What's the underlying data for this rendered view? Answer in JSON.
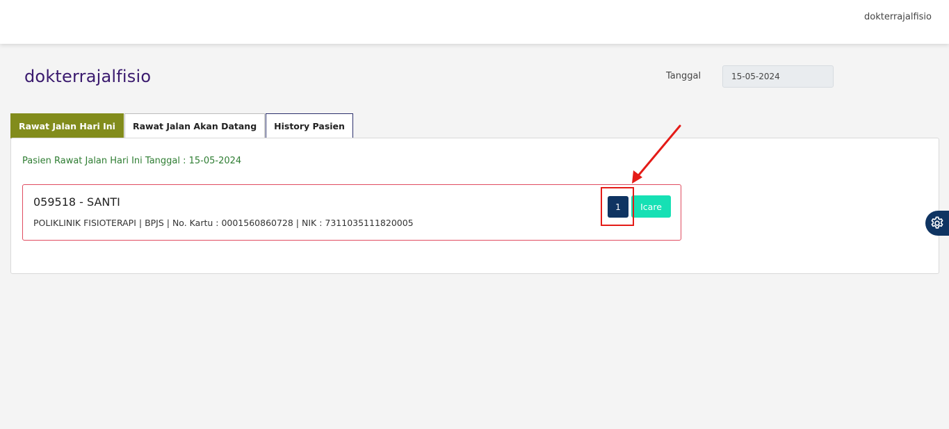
{
  "header": {
    "username": "dokterrajalfisio"
  },
  "page": {
    "title": "dokterrajalfisio",
    "date_label": "Tanggal",
    "date_value": "15-05-2024"
  },
  "tabs": [
    {
      "label": "Rawat Jalan Hari Ini",
      "active": true
    },
    {
      "label": "Rawat Jalan Akan Datang",
      "active": false
    },
    {
      "label": "History Pasien",
      "active": false
    }
  ],
  "panel": {
    "heading": "Pasien Rawat Jalan Hari Ini Tanggal : 15-05-2024",
    "patients": [
      {
        "name": "059518 - SANTI",
        "info": "POLIKLINIK FISIOTERAPI | BPJS | No. Kartu : 0001560860728 | NIK : 7311035111820005",
        "queue_label": "1",
        "icare_label": "Icare"
      }
    ]
  },
  "icons": {
    "settings": "gear-icon"
  },
  "colors": {
    "title": "#3a1a6e",
    "active_tab": "#828c1c",
    "queue_button": "#0f3462",
    "icare_button": "#16e0b4",
    "card_border": "#e04b5f",
    "annotation": "#e41b17",
    "heading_green": "#2e7d32"
  }
}
